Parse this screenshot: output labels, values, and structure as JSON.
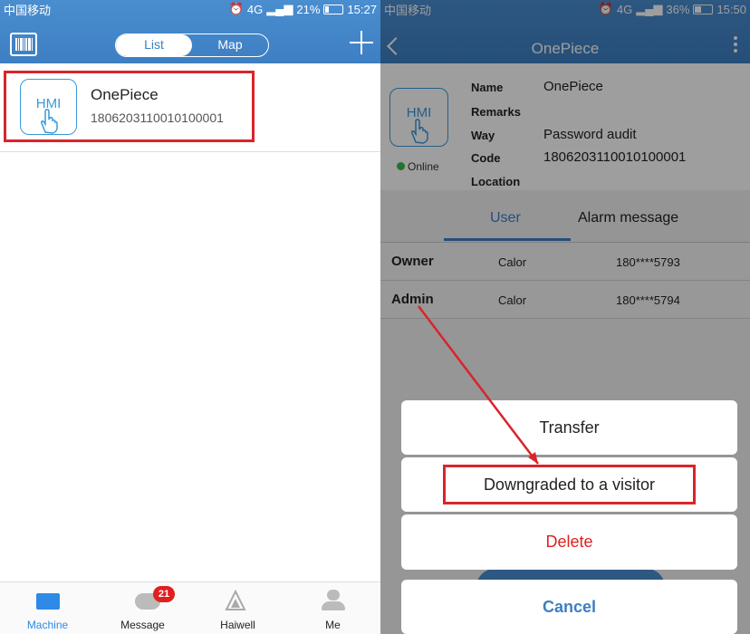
{
  "left": {
    "status": {
      "carrier": "中国移动",
      "network": "4G",
      "battery": "21%",
      "time": "15:27",
      "battery_level": 0.21
    },
    "toggle": {
      "list": "List",
      "map": "Map"
    },
    "device": {
      "hmi": "HMI",
      "name": "OnePiece",
      "code": "1806203110010100001"
    },
    "tabbar": [
      {
        "label": "Machine",
        "icon": "machine-icon",
        "active": true
      },
      {
        "label": "Message",
        "icon": "message-icon",
        "badge": "21"
      },
      {
        "label": "Haiwell",
        "icon": "haiwell-icon"
      },
      {
        "label": "Me",
        "icon": "user-icon"
      }
    ]
  },
  "right": {
    "status": {
      "carrier": "中国移动",
      "network": "4G",
      "battery": "36%",
      "time": "15:50",
      "battery_level": 0.36
    },
    "title": "OnePiece",
    "hmi": "HMI",
    "online": "Online",
    "info": {
      "name_label": "Name",
      "name_value": "OnePiece",
      "remarks_label": "Remarks",
      "way_label": "Way",
      "way_value": "Password audit",
      "code_label": "Code",
      "code_value": "1806203110010100001",
      "location_label": "Location"
    },
    "tabs": {
      "user": "User",
      "alarm": "Alarm message"
    },
    "users": [
      {
        "role": "Owner",
        "name": "Calor",
        "phone": "180****5793"
      },
      {
        "role": "Admin",
        "name": "Calor",
        "phone": "180****5794"
      }
    ],
    "actions": {
      "transfer": "Transfer",
      "downgrade": "Downgraded to a visitor",
      "delete": "Delete",
      "cancel": "Cancel"
    }
  },
  "colors": {
    "header_blue": "#3d7fc2",
    "highlight_red": "#d9242a",
    "delete_red": "#e02020",
    "online_green": "#3cb84a"
  }
}
